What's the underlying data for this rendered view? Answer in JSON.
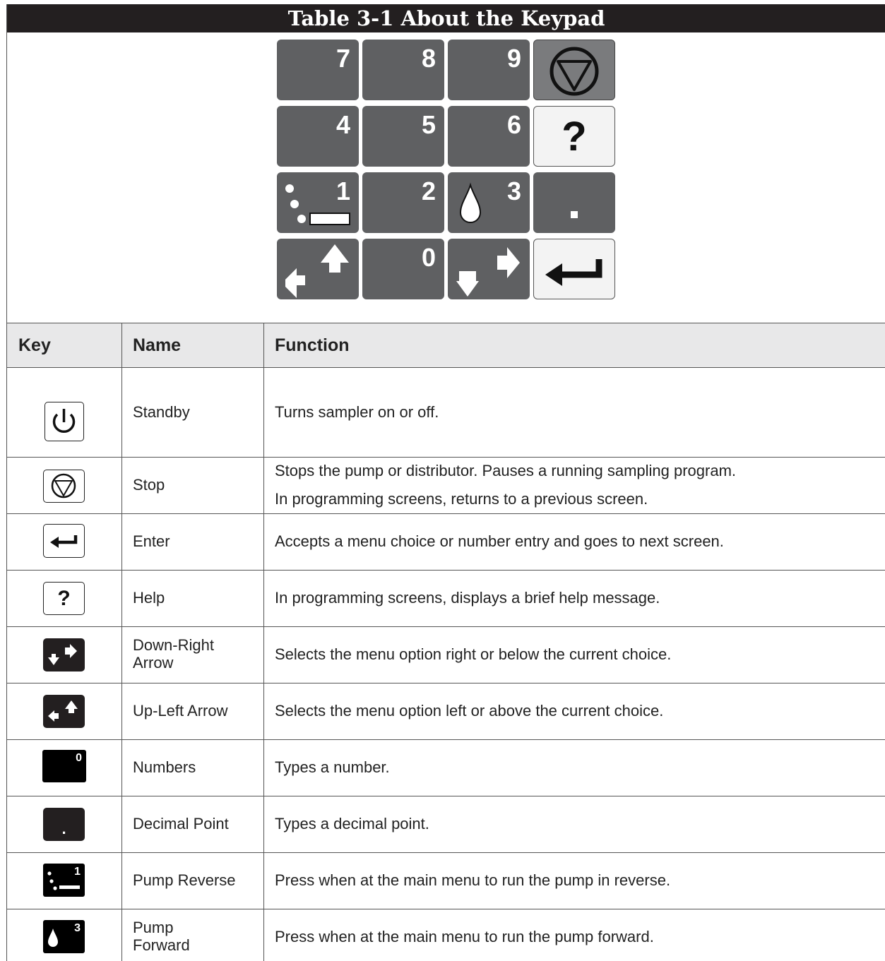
{
  "title": "Table 3-1  About the Keypad",
  "keypad": {
    "digits": [
      "7",
      "8",
      "9",
      "4",
      "5",
      "6",
      "1",
      "2",
      "3",
      "0"
    ],
    "help_glyph": "?",
    "decimal_glyph": "."
  },
  "table": {
    "headers": {
      "key": "Key",
      "name": "Name",
      "function": "Function"
    },
    "rows": [
      {
        "name": "Standby",
        "function": [
          "Turns sampler on or off."
        ]
      },
      {
        "name": "Stop",
        "function": [
          "Stops the pump or distributor. Pauses a running sampling program.",
          "In programming screens, returns to a previous screen."
        ]
      },
      {
        "name": "Enter",
        "function": [
          "Accepts a menu choice or number entry and goes to next screen."
        ]
      },
      {
        "name": "Help",
        "function": [
          "In programming screens, displays a brief help message."
        ]
      },
      {
        "name": "Down-Right Arrow",
        "function": [
          "Selects the menu option right or below the current choice."
        ]
      },
      {
        "name": "Up-Left Arrow",
        "function": [
          "Selects the menu option left or above the current choice."
        ]
      },
      {
        "name": "Numbers",
        "function": [
          "Types a number."
        ]
      },
      {
        "name": "Decimal Point",
        "function": [
          "Types a decimal point."
        ]
      },
      {
        "name": "Pump Reverse",
        "function": [
          "Press when at the main menu to run the pump in reverse."
        ]
      },
      {
        "name": "Pump Forward",
        "function": [
          "Press when at the main menu to run the pump forward."
        ]
      }
    ],
    "icon_labels": {
      "help": "?",
      "numbers": "0",
      "decimal": ".",
      "pump_reverse": "1",
      "pump_forward": "3"
    }
  },
  "icons": [
    "power-icon",
    "stop-icon",
    "enter-arrow-icon",
    "help-icon",
    "down-right-arrow-icon",
    "up-left-arrow-icon",
    "number-key-icon",
    "decimal-key-icon",
    "pump-reverse-icon",
    "pump-forward-icon"
  ],
  "colors": {
    "title_bg": "#231f20",
    "key_dark": "#5f6062",
    "header_bg": "#e8e8e9"
  }
}
